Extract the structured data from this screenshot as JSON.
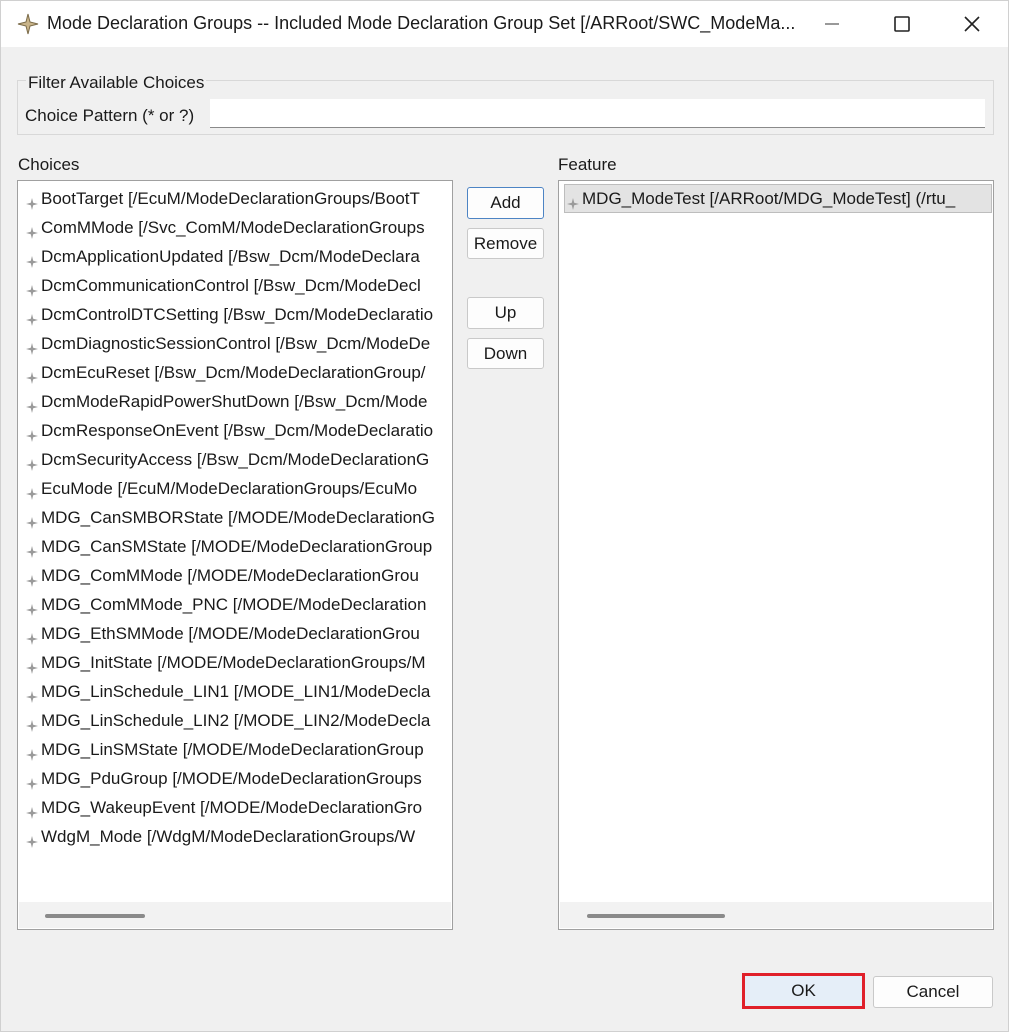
{
  "window": {
    "title": "Mode Declaration Groups -- Included Mode Declaration Group Set [/ARRoot/SWC_ModeMa...",
    "icon": "autosar-diamond-icon",
    "controls": [
      "minimize-icon",
      "maximize-icon",
      "close-icon"
    ]
  },
  "filter": {
    "legend": "Filter Available Choices",
    "pattern_label": "Choice Pattern (* or ?)",
    "pattern_value": ""
  },
  "choices": {
    "label": "Choices",
    "items": [
      "BootTarget [/EcuM/ModeDeclarationGroups/BootT",
      "ComMMode [/Svc_ComM/ModeDeclarationGroups",
      "DcmApplicationUpdated [/Bsw_Dcm/ModeDeclara",
      "DcmCommunicationControl [/Bsw_Dcm/ModeDecl",
      "DcmControlDTCSetting [/Bsw_Dcm/ModeDeclaratio",
      "DcmDiagnosticSessionControl [/Bsw_Dcm/ModeDe",
      "DcmEcuReset [/Bsw_Dcm/ModeDeclarationGroup/",
      "DcmModeRapidPowerShutDown [/Bsw_Dcm/Mode",
      "DcmResponseOnEvent [/Bsw_Dcm/ModeDeclaratio",
      "DcmSecurityAccess [/Bsw_Dcm/ModeDeclarationG",
      "EcuMode [/EcuM/ModeDeclarationGroups/EcuMo",
      "MDG_CanSMBORState [/MODE/ModeDeclarationG",
      "MDG_CanSMState [/MODE/ModeDeclarationGroup",
      "MDG_ComMMode [/MODE/ModeDeclarationGrou",
      "MDG_ComMMode_PNC [/MODE/ModeDeclaration",
      "MDG_EthSMMode [/MODE/ModeDeclarationGrou",
      "MDG_InitState [/MODE/ModeDeclarationGroups/M",
      "MDG_LinSchedule_LIN1 [/MODE_LIN1/ModeDecla",
      "MDG_LinSchedule_LIN2 [/MODE_LIN2/ModeDecla",
      "MDG_LinSMState [/MODE/ModeDeclarationGroup",
      "MDG_PduGroup [/MODE/ModeDeclarationGroups",
      "MDG_WakeupEvent [/MODE/ModeDeclarationGro",
      "WdgM_Mode [/WdgM/ModeDeclarationGroups/W"
    ]
  },
  "buttons": {
    "add": "Add",
    "remove": "Remove",
    "up": "Up",
    "down": "Down",
    "ok": "OK",
    "cancel": "Cancel"
  },
  "feature": {
    "label": "Feature",
    "items": [
      "MDG_ModeTest [/ARRoot/MDG_ModeTest] (/rtu_"
    ]
  },
  "colors": {
    "highlight_border": "#e0202a",
    "default_button_border": "#4d84c4",
    "selected_row": "#e3e3e3"
  }
}
